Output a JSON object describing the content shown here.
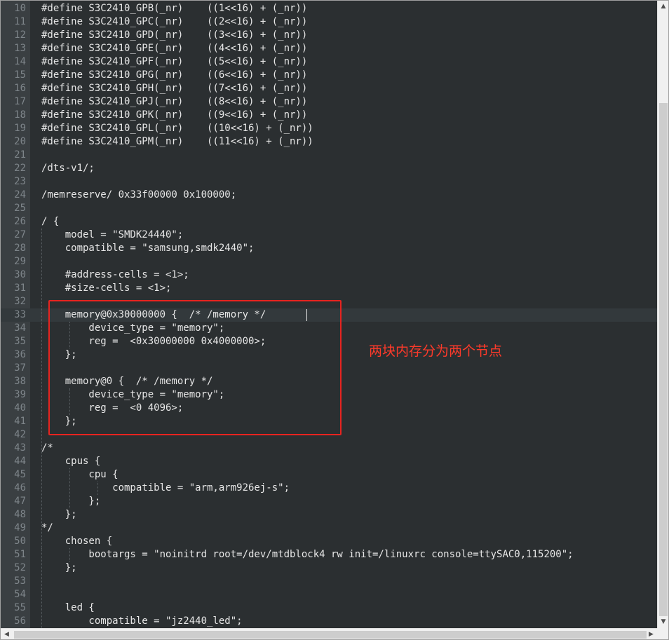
{
  "editor": {
    "lines": [
      {
        "number": "10",
        "text": "#define S3C2410_GPB(_nr)    ((1<<16) + (_nr))"
      },
      {
        "number": "11",
        "text": "#define S3C2410_GPC(_nr)    ((2<<16) + (_nr))"
      },
      {
        "number": "12",
        "text": "#define S3C2410_GPD(_nr)    ((3<<16) + (_nr))"
      },
      {
        "number": "13",
        "text": "#define S3C2410_GPE(_nr)    ((4<<16) + (_nr))"
      },
      {
        "number": "14",
        "text": "#define S3C2410_GPF(_nr)    ((5<<16) + (_nr))"
      },
      {
        "number": "15",
        "text": "#define S3C2410_GPG(_nr)    ((6<<16) + (_nr))"
      },
      {
        "number": "16",
        "text": "#define S3C2410_GPH(_nr)    ((7<<16) + (_nr))"
      },
      {
        "number": "17",
        "text": "#define S3C2410_GPJ(_nr)    ((8<<16) + (_nr))"
      },
      {
        "number": "18",
        "text": "#define S3C2410_GPK(_nr)    ((9<<16) + (_nr))"
      },
      {
        "number": "19",
        "text": "#define S3C2410_GPL(_nr)    ((10<<16) + (_nr))"
      },
      {
        "number": "20",
        "text": "#define S3C2410_GPM(_nr)    ((11<<16) + (_nr))"
      },
      {
        "number": "21",
        "text": ""
      },
      {
        "number": "22",
        "text": "/dts-v1/;"
      },
      {
        "number": "23",
        "text": ""
      },
      {
        "number": "24",
        "text": "/memreserve/ 0x33f00000 0x100000;"
      },
      {
        "number": "25",
        "text": ""
      },
      {
        "number": "26",
        "text": "/ {"
      },
      {
        "number": "27",
        "text": "    model = \"SMDK24440\";"
      },
      {
        "number": "28",
        "text": "    compatible = \"samsung,smdk2440\";"
      },
      {
        "number": "29",
        "text": ""
      },
      {
        "number": "30",
        "text": "    #address-cells = <1>;"
      },
      {
        "number": "31",
        "text": "    #size-cells = <1>;"
      },
      {
        "number": "32",
        "text": ""
      },
      {
        "number": "33",
        "text": "    memory@0x30000000 {  /* /memory */"
      },
      {
        "number": "34",
        "text": "        device_type = \"memory\";"
      },
      {
        "number": "35",
        "text": "        reg =  <0x30000000 0x4000000>;"
      },
      {
        "number": "36",
        "text": "    };"
      },
      {
        "number": "37",
        "text": ""
      },
      {
        "number": "38",
        "text": "    memory@0 {  /* /memory */"
      },
      {
        "number": "39",
        "text": "        device_type = \"memory\";"
      },
      {
        "number": "40",
        "text": "        reg =  <0 4096>;"
      },
      {
        "number": "41",
        "text": "    };"
      },
      {
        "number": "42",
        "text": ""
      },
      {
        "number": "43",
        "text": "/*"
      },
      {
        "number": "44",
        "text": "    cpus {"
      },
      {
        "number": "45",
        "text": "        cpu {"
      },
      {
        "number": "46",
        "text": "            compatible = \"arm,arm926ej-s\";"
      },
      {
        "number": "47",
        "text": "        };"
      },
      {
        "number": "48",
        "text": "    };"
      },
      {
        "number": "49",
        "text": "*/"
      },
      {
        "number": "50",
        "text": "    chosen {"
      },
      {
        "number": "51",
        "text": "        bootargs = \"noinitrd root=/dev/mtdblock4 rw init=/linuxrc console=ttySAC0,115200\";"
      },
      {
        "number": "52",
        "text": "    };"
      },
      {
        "number": "53",
        "text": ""
      },
      {
        "number": "54",
        "text": ""
      },
      {
        "number": "55",
        "text": "    led {"
      },
      {
        "number": "56",
        "text": "        compatible = \"jz2440_led\";"
      }
    ],
    "current_line": "33"
  },
  "annotation": {
    "text": "两块内存分为两个节点",
    "color": "#e8231f"
  },
  "scrollbars": {
    "up_arrow": "▲",
    "down_arrow": "▼",
    "left_arrow": "◀",
    "right_arrow": "▶"
  }
}
